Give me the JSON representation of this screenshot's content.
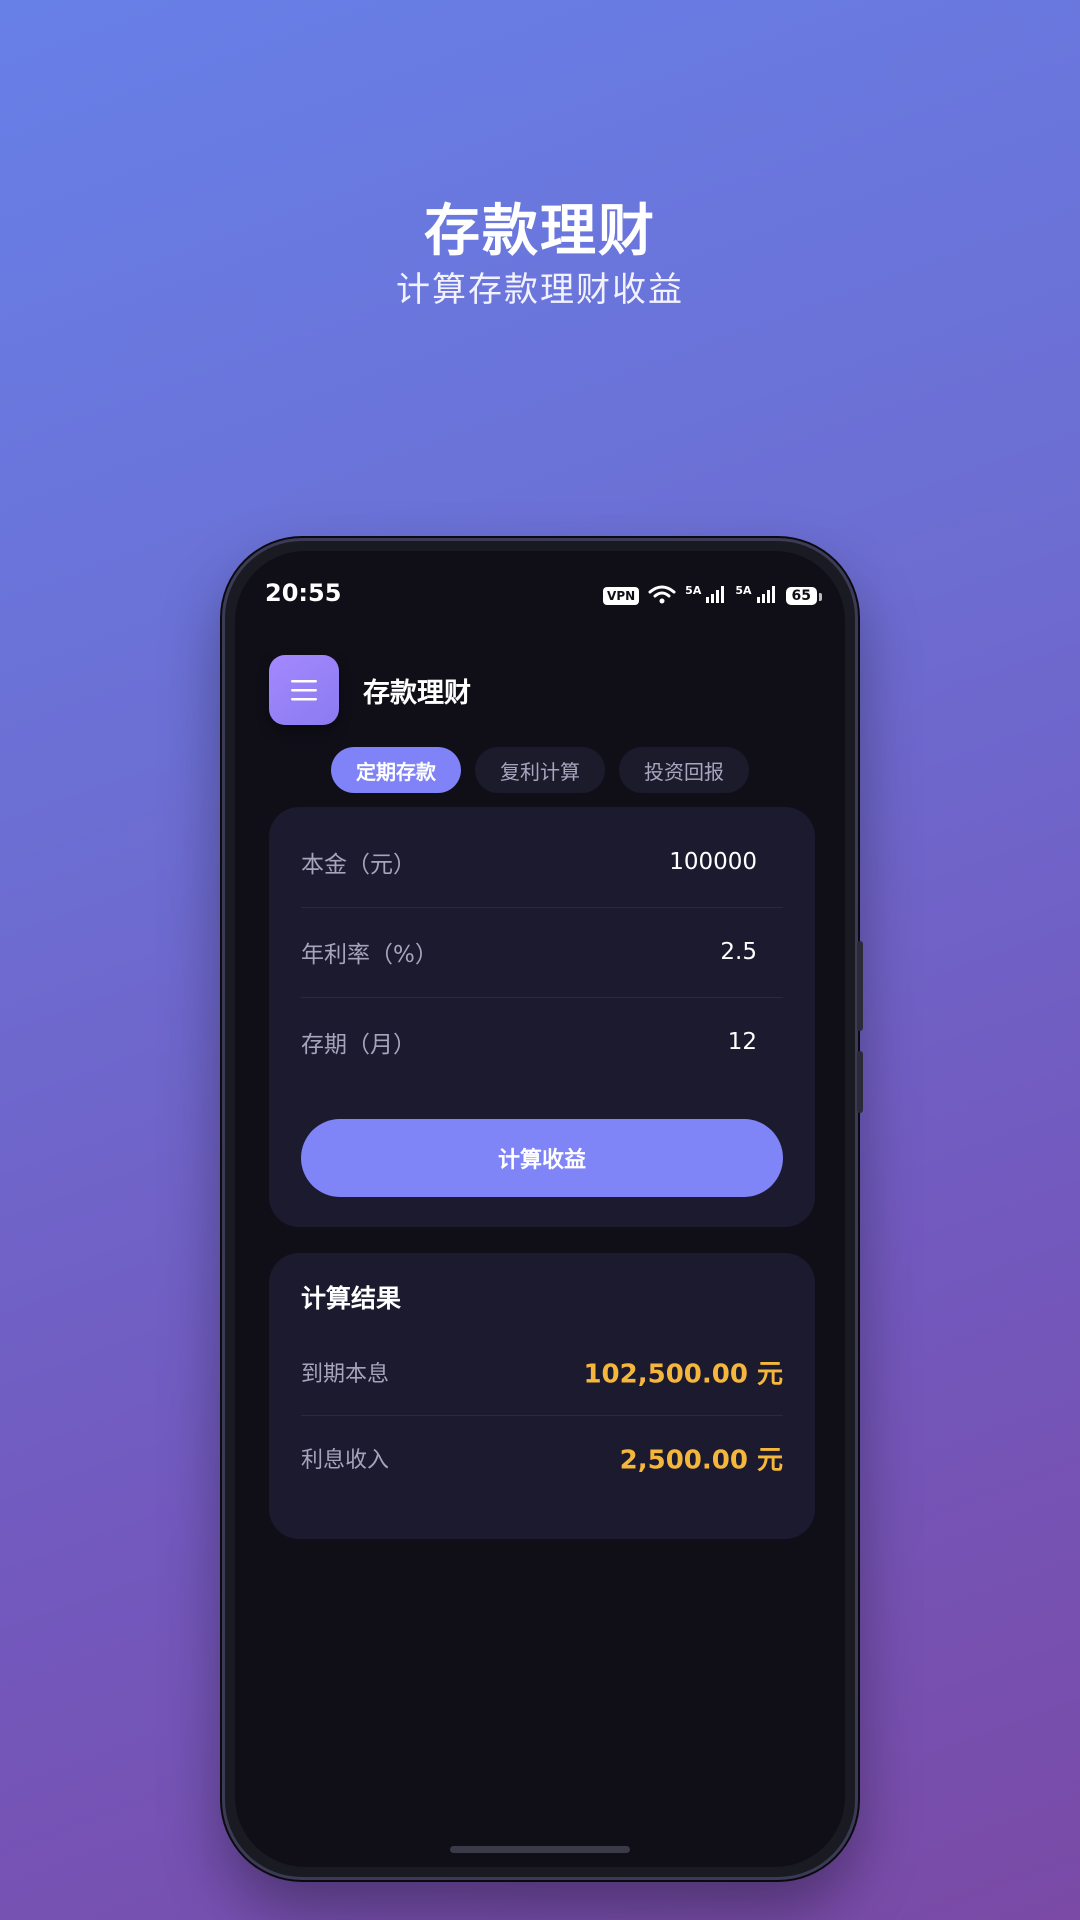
{
  "promo": {
    "title": "存款理财",
    "subtitle": "计算存款理财收益"
  },
  "status_bar": {
    "time": "20:55",
    "vpn": "VPN",
    "network_1": "5A",
    "network_2": "5A",
    "battery": "65"
  },
  "header": {
    "menu_icon": "menu-icon",
    "title": "存款理财"
  },
  "tabs": [
    {
      "label": "定期存款",
      "active": true
    },
    {
      "label": "复利计算",
      "active": false
    },
    {
      "label": "投资回报",
      "active": false
    }
  ],
  "form": {
    "fields": [
      {
        "label": "本金（元）",
        "value": "100000"
      },
      {
        "label": "年利率（%）",
        "value": "2.5"
      },
      {
        "label": "存期（月）",
        "value": "12"
      }
    ],
    "submit_label": "计算收益"
  },
  "results": {
    "heading": "计算结果",
    "rows": [
      {
        "label": "到期本息",
        "value": "102,500.00 元"
      },
      {
        "label": "利息收入",
        "value": "2,500.00 元"
      }
    ]
  },
  "colors": {
    "accent": "#7f85f6",
    "result_value": "#f5b73b",
    "card_bg": "#1b1a2f",
    "screen_bg": "#100f18"
  }
}
